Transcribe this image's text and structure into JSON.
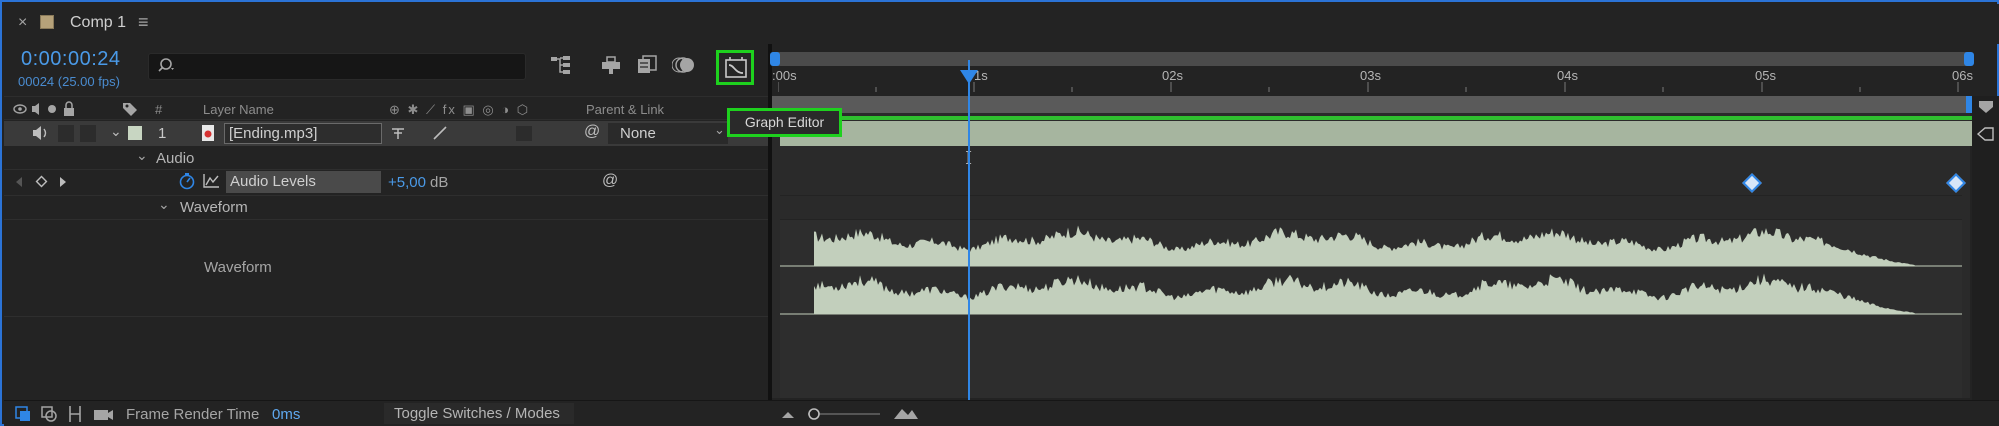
{
  "tab": {
    "close": "×",
    "label": "Comp 1",
    "menu": "≡"
  },
  "time": {
    "timecode": "0:00:00:24",
    "frames": "00024 (25.00 fps)"
  },
  "search": {
    "icon": "⌕",
    "placeholder": ""
  },
  "tools": [
    {
      "icon": "comp-flowchart-icon",
      "glyph": "⊶"
    },
    {
      "icon": "draft-3d-icon",
      "glyph": "⊥"
    },
    {
      "icon": "frame-blending-icon",
      "glyph": "▤"
    },
    {
      "icon": "motion-blur-icon",
      "glyph": "◎"
    },
    {
      "icon": "graph-editor-icon",
      "glyph": "⌗"
    }
  ],
  "ruler": {
    "labels": [
      ":00s",
      "1s",
      "02s",
      "03s",
      "04s",
      "05s",
      "06s"
    ]
  },
  "columns": {
    "number": "#",
    "layer_name": "Layer Name",
    "switches": "⊕ ✱ ⟋ fx ▣ ◎ ◑ ⬡",
    "parent_link": "Parent & Link"
  },
  "layer": {
    "index": "1",
    "name": "[Ending.mp3]",
    "parent": "None",
    "pickwhip": "@",
    "dropdown": "⌄"
  },
  "audio": {
    "group_label": "Audio",
    "property": "Audio Levels",
    "value": "+5,00",
    "unit": "dB",
    "pickwhip": "@"
  },
  "waveform": {
    "group_label": "Waveform",
    "property_label": "Waveform"
  },
  "tooltip": {
    "text": "Graph Editor"
  },
  "bottom": {
    "frame_render_label": "Frame Render Time",
    "frame_render_value": "0ms",
    "toggle_label": "Toggle Switches / Modes"
  },
  "colors": {
    "accent_blue": "#2f86e6",
    "highlight_green": "#1ed11e",
    "layer_bar": "#a6b59f",
    "waveform": "#c2cfbc"
  }
}
